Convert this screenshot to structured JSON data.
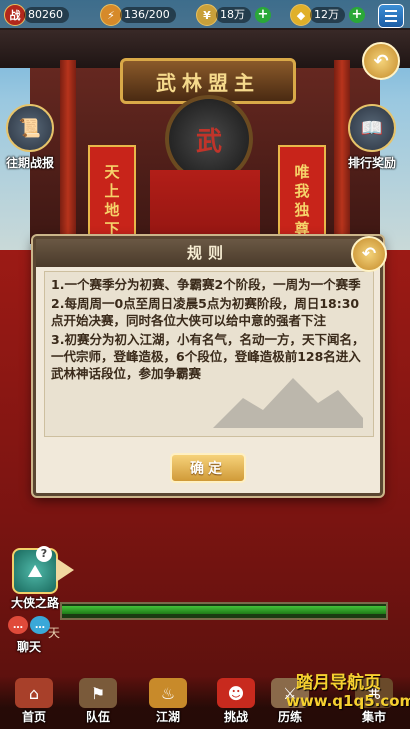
{
  "topbar": {
    "avatar_text": "战",
    "power": "80260",
    "stamina": "136/200",
    "silver": "18万",
    "gold": "12万",
    "plus_symbol": "+"
  },
  "scene": {
    "plaque_text": "武林盟主",
    "drum_text": "武",
    "banner_left": "天上地下",
    "banner_right": "唯我独尊"
  },
  "side": {
    "history_label": "往期战报",
    "ranking_label": "排行奖励",
    "back_symbol": "↶"
  },
  "dialog": {
    "title": "规则",
    "rules": [
      "1.一个赛季分为初赛、争霸赛2个阶段，一周为一个赛季",
      "2.每周周一0点至周日凌晨5点为初赛阶段，周日18:30点开始决赛，同时各位大侠可以给中意的强者下注",
      "3.初赛分为初入江湖，小有名气，名动一方，天下闻名，一代宗师，登峰造极，6个段位，登峰造极前128名进入武林神话段位，参加争霸赛"
    ],
    "confirm_label": "确定",
    "close_symbol": "↶"
  },
  "widgets": {
    "hero_road_label": "大侠之路",
    "hero_badge": "?",
    "chat_label": "聊天",
    "chat_partial": "天"
  },
  "nav": {
    "items": [
      {
        "label": "首页",
        "icon": "home-icon"
      },
      {
        "label": "队伍",
        "icon": "team-icon"
      },
      {
        "label": "江湖",
        "icon": "gourd-icon"
      },
      {
        "label": "挑战",
        "icon": "mask-icon"
      },
      {
        "label": "历练",
        "icon": "training-icon"
      },
      {
        "label": "集市",
        "icon": "market-icon"
      }
    ]
  },
  "watermark": {
    "line1": "踏月导航页",
    "line2": "www.q1q5.com"
  },
  "colors": {
    "accent_gold": "#e6c36a",
    "dialog_bg": "#f1e9da",
    "dialog_header": "#4a3a2a",
    "wall_red": "#9c1a15",
    "progress_green": "#44c33a"
  }
}
